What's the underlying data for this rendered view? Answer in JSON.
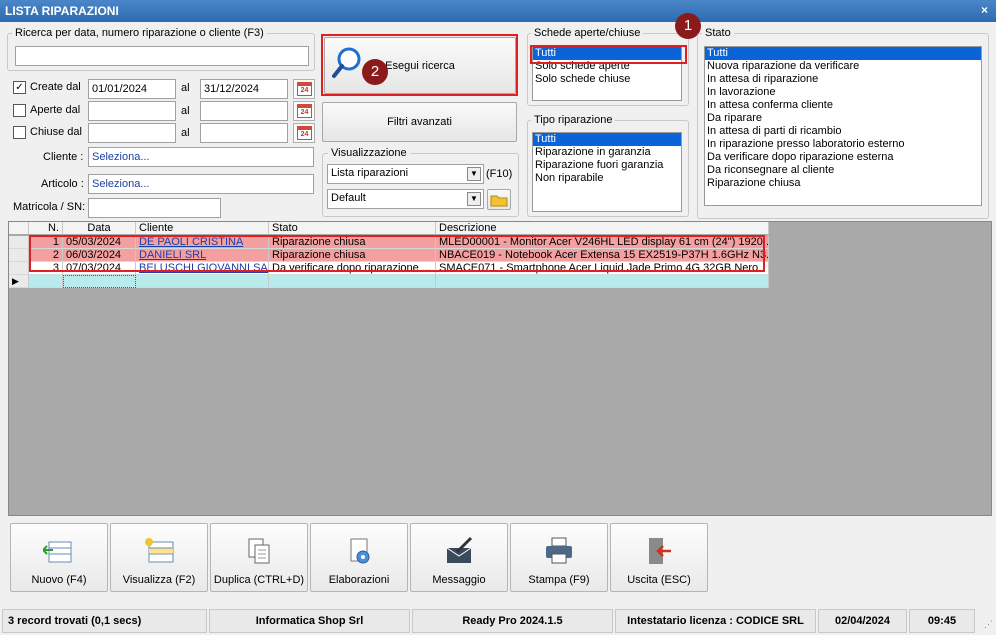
{
  "window": {
    "title": "LISTA RIPARAZIONI",
    "close": "×"
  },
  "search": {
    "label": "Ricerca per data, numero riparazione o cliente (F3)",
    "value": ""
  },
  "dates": {
    "created": {
      "label": "Create dal",
      "checked": "✓",
      "from": "01/01/2024",
      "to": "31/12/2024",
      "al": "al"
    },
    "opened": {
      "label": "Aperte dal",
      "from": "",
      "to": "",
      "al": "al"
    },
    "closed": {
      "label": "Chiuse dal",
      "from": "",
      "to": "",
      "al": "al"
    },
    "cal_day": "24"
  },
  "fields": {
    "cliente_label": "Cliente :",
    "cliente_value": "Seleziona...",
    "articolo_label": "Articolo :",
    "articolo_value": "Seleziona...",
    "matricola_label": "Matricola / SN:",
    "matricola_value": ""
  },
  "buttons": {
    "search": "Esegui ricerca",
    "advanced": "Filtri avanzati"
  },
  "visualizzazione": {
    "label": "Visualizzazione",
    "view": "Lista riparazioni",
    "f10": "(F10)",
    "layout": "Default"
  },
  "schede": {
    "label": "Schede aperte/chiuse",
    "items": [
      "Tutti",
      "Solo schede aperte",
      "Solo schede chiuse"
    ],
    "selected": 0
  },
  "tipo": {
    "label": "Tipo riparazione",
    "items": [
      "Tutti",
      "Riparazione in garanzia",
      "Riparazione fuori garanzia",
      "Non riparabile"
    ],
    "selected": 0
  },
  "stato": {
    "label": "Stato",
    "items": [
      "Tutti",
      "Nuova riparazione da verificare",
      "In attesa di riparazione",
      "In lavorazione",
      "In attesa conferma cliente",
      "Da riparare",
      "In attesa di parti di ricambio",
      "In riparazione presso laboratorio esterno",
      "Da verificare dopo riparazione esterna",
      "Da riconsegnare al cliente",
      "Riparazione chiusa"
    ],
    "selected": 0
  },
  "badges": [
    "1",
    "2"
  ],
  "grid": {
    "headers": [
      "N.",
      "Data",
      "Cliente",
      "Stato",
      "Descrizione"
    ],
    "rows": [
      {
        "n": "1",
        "data": "05/03/2024",
        "cliente": "DE PAOLI CRISTINA",
        "stato": "Riparazione chiusa",
        "descrizione": "MLED00001 - Monitor Acer V246HL LED display 61 cm (24\") 1920 ..."
      },
      {
        "n": "2",
        "data": "06/03/2024",
        "cliente": "DANIELI SRL",
        "stato": "Riparazione chiusa",
        "descrizione": "NBACE019 - Notebook Acer Extensa 15 EX2519-P37H 1.6GHz N3..."
      },
      {
        "n": "3",
        "data": "07/03/2024",
        "cliente": "BELUSCHI GIOVANNI SAS",
        "stato": "Da verificare dopo riparazione ...",
        "descrizione": "SMACE071 - Smartphone Acer Liquid Jade Primo 4G 32GB Nero"
      }
    ],
    "new_row_marker": "▶"
  },
  "toolbar": [
    "Nuovo (F4)",
    "Visualizza (F2)",
    "Duplica (CTRL+D)",
    "Elaborazioni",
    "Messaggio",
    "Stampa (F9)",
    "Uscita (ESC)"
  ],
  "status": {
    "records": "3 record trovati (0,1 secs)",
    "company": "Informatica Shop Srl",
    "version": "Ready Pro 2024.1.5",
    "license": "Intestatario licenza : CODICE SRL",
    "date": "02/04/2024",
    "time": "09:45"
  },
  "colors": {
    "selection": "#0a64d8",
    "highlight": "#f5a0a0",
    "newrow": "#b8ecec",
    "redbox": "#e02020",
    "badge": "#8b1a1a"
  }
}
